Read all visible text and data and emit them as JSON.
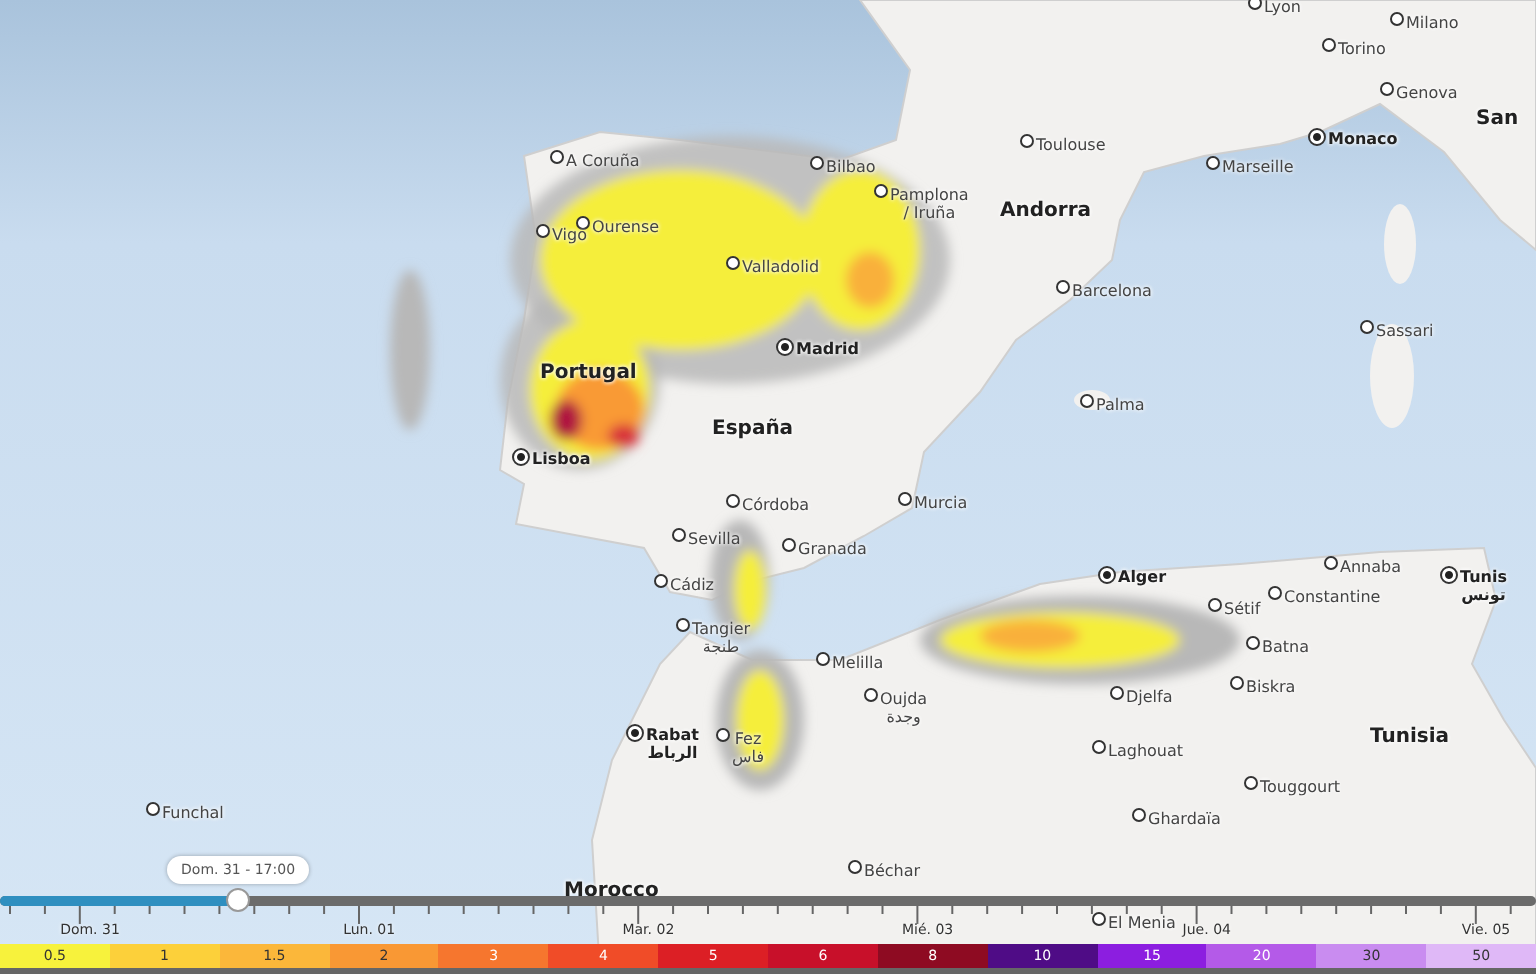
{
  "map": {
    "labels": [
      {
        "text": "Lyon",
        "kind": "city"
      },
      {
        "text": "Milano",
        "kind": "city"
      },
      {
        "text": "Torino",
        "kind": "city"
      },
      {
        "text": "Genova",
        "kind": "city"
      },
      {
        "text": "San",
        "kind": "country"
      },
      {
        "text": "Monaco",
        "kind": "capital"
      },
      {
        "text": "Toulouse",
        "kind": "city"
      },
      {
        "text": "A Coruña",
        "kind": "city"
      },
      {
        "text": "Bilbao",
        "kind": "city"
      },
      {
        "text": "Marseille",
        "kind": "city"
      },
      {
        "text": "Pamplona",
        "sub": "/ Iruña",
        "kind": "city"
      },
      {
        "text": "Andorra",
        "kind": "country"
      },
      {
        "text": "Ourense",
        "kind": "city"
      },
      {
        "text": "Vigo",
        "kind": "city"
      },
      {
        "text": "Valladolid",
        "kind": "city"
      },
      {
        "text": "Barcelona",
        "kind": "city"
      },
      {
        "text": "Sassari",
        "kind": "city"
      },
      {
        "text": "Madrid",
        "kind": "capital"
      },
      {
        "text": "Portugal",
        "kind": "country"
      },
      {
        "text": "Palma",
        "kind": "city"
      },
      {
        "text": "España",
        "kind": "country"
      },
      {
        "text": "Lisboa",
        "kind": "capital"
      },
      {
        "text": "Córdoba",
        "kind": "city"
      },
      {
        "text": "Murcia",
        "kind": "city"
      },
      {
        "text": "Sevilla",
        "kind": "city"
      },
      {
        "text": "Granada",
        "kind": "city"
      },
      {
        "text": "Cádiz",
        "kind": "city"
      },
      {
        "text": "Alger",
        "kind": "capital"
      },
      {
        "text": "Annaba",
        "kind": "city"
      },
      {
        "text": "Constantine",
        "kind": "city"
      },
      {
        "text": "Tunis",
        "sub": "تونس",
        "kind": "capital"
      },
      {
        "text": "Sétif",
        "kind": "city"
      },
      {
        "text": "Tangier",
        "sub": "طنجة",
        "kind": "city"
      },
      {
        "text": "Batna",
        "kind": "city"
      },
      {
        "text": "Melilla",
        "kind": "city"
      },
      {
        "text": "Oujda",
        "sub": "وجدة",
        "kind": "city"
      },
      {
        "text": "Djelfa",
        "kind": "city"
      },
      {
        "text": "Biskra",
        "kind": "city"
      },
      {
        "text": "Rabat",
        "sub": "الرباط",
        "kind": "capital"
      },
      {
        "text": "Fez",
        "sub": "فاس",
        "kind": "city"
      },
      {
        "text": "Tunisia",
        "kind": "country"
      },
      {
        "text": "Laghouat",
        "kind": "city"
      },
      {
        "text": "Touggourt",
        "kind": "city"
      },
      {
        "text": "Funchal",
        "kind": "city"
      },
      {
        "text": "Ghardaïa",
        "kind": "city"
      },
      {
        "text": "Béchar",
        "kind": "city"
      },
      {
        "text": "Morocco",
        "kind": "country"
      },
      {
        "text": "El Menia",
        "kind": "city"
      }
    ]
  },
  "timeline": {
    "tooltip": "Dom. 31 - 17:00",
    "level": 0.155,
    "days": [
      "Dom. 31",
      "Lun. 01",
      "Mar. 02",
      "Mié. 03",
      "Jue. 04",
      "Vie. 05"
    ]
  },
  "legend": {
    "steps": [
      {
        "label": "0.5",
        "color": "#f7f23c"
      },
      {
        "label": "1",
        "color": "#fcd03a"
      },
      {
        "label": "1.5",
        "color": "#fbb73a"
      },
      {
        "label": "2",
        "color": "#f99834"
      },
      {
        "label": "3",
        "color": "#f6762e"
      },
      {
        "label": "4",
        "color": "#f04c28"
      },
      {
        "label": "5",
        "color": "#dc1f25"
      },
      {
        "label": "6",
        "color": "#c8102a"
      },
      {
        "label": "8",
        "color": "#8e0b22"
      },
      {
        "label": "10",
        "color": "#4f0c86"
      },
      {
        "label": "15",
        "color": "#8c1ee0"
      },
      {
        "label": "20",
        "color": "#b45ae8"
      },
      {
        "label": "30",
        "color": "#c98cf0"
      },
      {
        "label": "50",
        "color": "#dfb8f7"
      }
    ]
  }
}
